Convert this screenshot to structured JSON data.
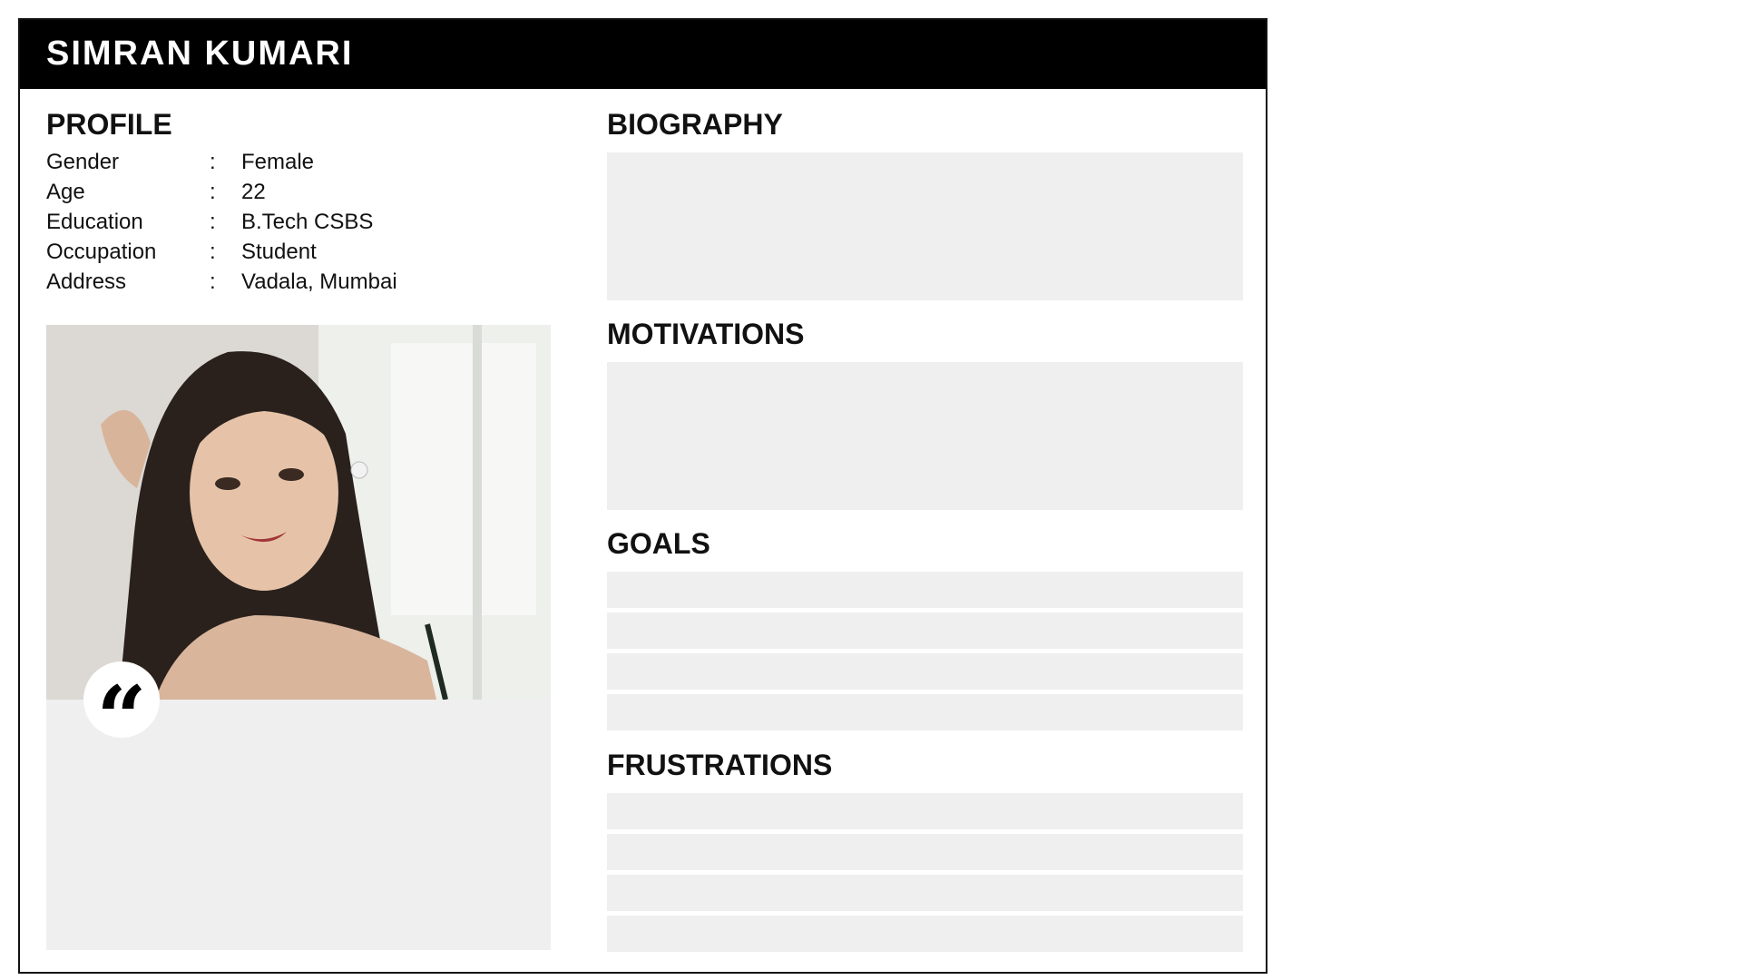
{
  "name": "SIMRAN KUMARI",
  "profile": {
    "title": "PROFILE",
    "rows": [
      {
        "label": "Gender",
        "sep": ":",
        "value": "Female"
      },
      {
        "label": "Age",
        "sep": ":",
        "value": "22"
      },
      {
        "label": "Education",
        "sep": ":",
        "value": "B.Tech CSBS"
      },
      {
        "label": "Occupation",
        "sep": ":",
        "value": "Student"
      },
      {
        "label": "Address",
        "sep": ":",
        "value": "Vadala, Mumbai"
      }
    ]
  },
  "quote_icon": "quote-icon",
  "biography": {
    "title": "BIOGRAPHY"
  },
  "motivations": {
    "title": "MOTIVATIONS"
  },
  "goals": {
    "title": "GOALS"
  },
  "frustrations": {
    "title": "FRUSTRATIONS"
  },
  "colors": {
    "header": "#000000",
    "placeholder": "#efefef",
    "text": "#111111"
  }
}
